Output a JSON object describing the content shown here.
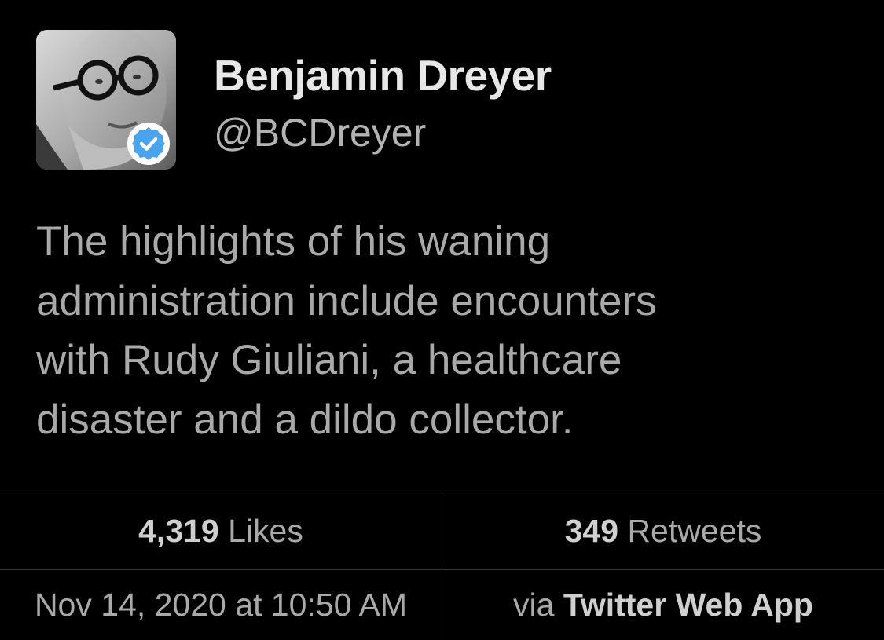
{
  "author": {
    "display_name": "Benjamin Dreyer",
    "handle": "@BCDreyer",
    "verified": true,
    "verified_color": "#4aa3ed"
  },
  "tweet": {
    "lines": [
      "The highlights of his waning",
      "administration include encounters",
      "with Rudy Giuliani, a healthcare",
      "disaster and a dildo collector."
    ]
  },
  "stats": {
    "likes_count": "4,319",
    "likes_label": "Likes",
    "retweets_count": "349",
    "retweets_label": "Retweets"
  },
  "meta": {
    "timestamp": "Nov 14, 2020 at 10:50 AM",
    "via_prefix": "via",
    "source": "Twitter Web App"
  },
  "icons": {
    "avatar": "profile-photo",
    "badge": "verified-checkmark-icon"
  }
}
